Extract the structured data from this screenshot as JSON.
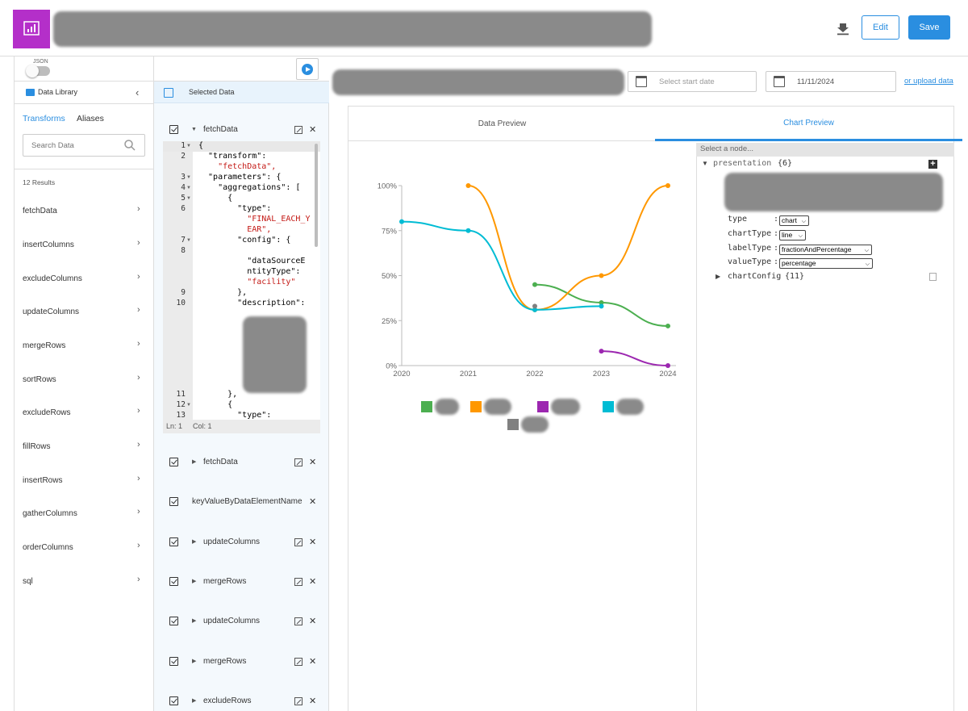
{
  "header": {
    "edit_label": "Edit",
    "save_label": "Save"
  },
  "toolbar": {
    "json_label": "JSON"
  },
  "library": {
    "title": "Data Library",
    "tabs": [
      "Transforms",
      "Aliases"
    ],
    "search_placeholder": "Search Data",
    "result_count": "12 Results",
    "items": [
      "fetchData",
      "insertColumns",
      "excludeColumns",
      "updateColumns",
      "mergeRows",
      "sortRows",
      "excludeRows",
      "fillRows",
      "insertRows",
      "gatherColumns",
      "orderColumns",
      "sql"
    ]
  },
  "selected": {
    "title": "Selected Data",
    "expanded_step": "fetchData",
    "editor": {
      "lines": [
        {
          "ln": "1",
          "code": "{"
        },
        {
          "ln": "2",
          "code": "  \"transform\":"
        },
        {
          "ln": "",
          "code": "    \"fetchData\",",
          "str": true
        },
        {
          "ln": "3",
          "code": "  \"parameters\": {"
        },
        {
          "ln": "4",
          "code": "    \"aggregations\": ["
        },
        {
          "ln": "5",
          "code": "      {"
        },
        {
          "ln": "6",
          "code": "        \"type\":"
        },
        {
          "ln": "",
          "code": "          \"FINAL_EACH_Y",
          "str": true
        },
        {
          "ln": "",
          "code": "          EAR\",",
          "str": true
        },
        {
          "ln": "7",
          "code": "        \"config\": {"
        },
        {
          "ln": "8",
          "code": ""
        },
        {
          "ln": "",
          "code": "          \"dataSourceE"
        },
        {
          "ln": "",
          "code": "          ntityType\":"
        },
        {
          "ln": "",
          "code": "          \"facility\"",
          "str": true
        },
        {
          "ln": "9",
          "code": "        },"
        },
        {
          "ln": "10",
          "code": "        \"description\":"
        },
        {
          "ln": "11",
          "code": "      },"
        },
        {
          "ln": "12",
          "code": "      {"
        },
        {
          "ln": "13",
          "code": "        \"type\":"
        }
      ],
      "status_ln": "Ln: 1",
      "status_col": "Col: 1"
    },
    "steps": [
      "fetchData",
      "keyValueByDataElementName",
      "updateColumns",
      "mergeRows",
      "updateColumns",
      "mergeRows",
      "excludeRows"
    ]
  },
  "dates": {
    "start_placeholder": "Select start date",
    "end_value": "11/11/2024",
    "upload_link": "or upload data"
  },
  "preview_tabs": [
    "Data Preview",
    "Chart Preview"
  ],
  "config": {
    "search_placeholder": "Select a node...",
    "presentation_label": "presentation",
    "presentation_count": "{6}",
    "props": [
      {
        "key": "type",
        "value": "chart"
      },
      {
        "key": "chartType",
        "value": "line"
      },
      {
        "key": "labelType",
        "value": "fractionAndPercentage"
      },
      {
        "key": "valueType",
        "value": "percentage"
      }
    ],
    "chart_config_label": "chartConfig",
    "chart_config_count": "{11}"
  },
  "chart_data": {
    "type": "line",
    "x": [
      2020,
      2021,
      2022,
      2023,
      2024
    ],
    "y_ticks": [
      "0%",
      "25%",
      "50%",
      "75%",
      "100%"
    ],
    "ylim": [
      0,
      1
    ],
    "series": [
      {
        "color": "#4caf50",
        "values": [
          null,
          null,
          0.45,
          0.35,
          0.22
        ]
      },
      {
        "color": "#ff9800",
        "values": [
          null,
          1.0,
          0.31,
          0.5,
          1.0
        ]
      },
      {
        "color": "#9c27b0",
        "values": [
          null,
          null,
          null,
          0.08,
          0.0
        ]
      },
      {
        "color": "#00bcd4",
        "values": [
          0.8,
          0.75,
          0.31,
          0.33,
          null
        ]
      },
      {
        "color": "#808080",
        "values": [
          null,
          null,
          0.33,
          null,
          null
        ]
      }
    ]
  }
}
